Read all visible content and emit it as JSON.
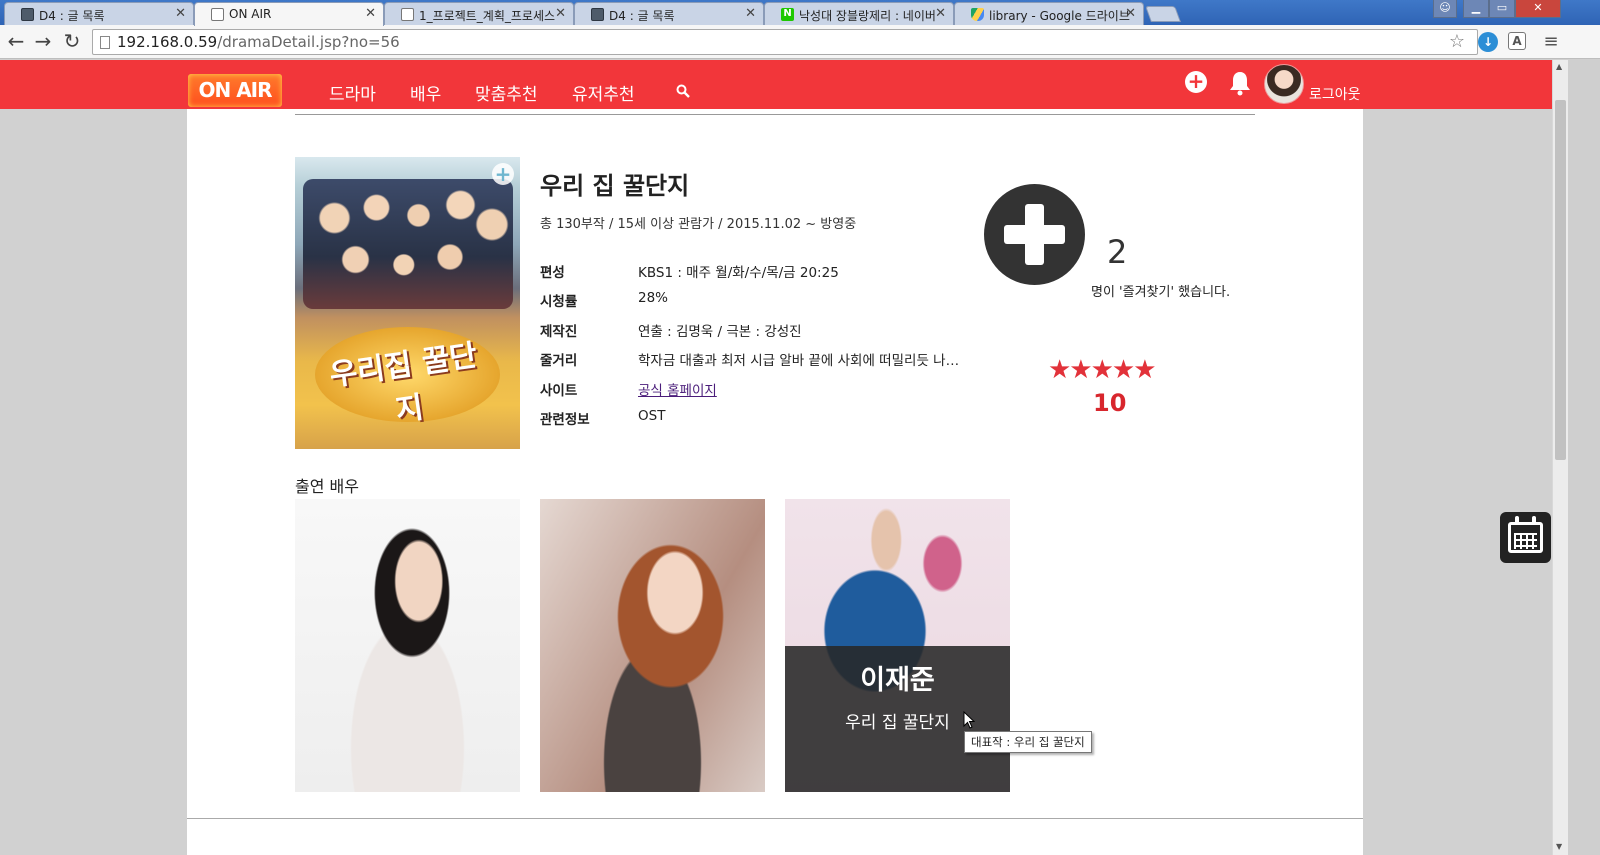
{
  "browser": {
    "tabs": [
      {
        "label": "D4 : 글 목록",
        "favicon": "db-icon"
      },
      {
        "label": "ON AIR",
        "favicon": "page-icon"
      },
      {
        "label": "1_프로젝트_계획_프로세스",
        "favicon": "page-icon"
      },
      {
        "label": "D4 : 글 목록",
        "favicon": "db-icon"
      },
      {
        "label": "낙성대 장블랑제리 : 네이버",
        "favicon": "naver-icon"
      },
      {
        "label": "library - Google 드라이브",
        "favicon": "drive-icon"
      }
    ],
    "url_host": "192.168.0.59",
    "url_path": "/dramaDetail.jsp?no=56"
  },
  "site": {
    "logo": "ON AIR",
    "nav": [
      "드라마",
      "배우",
      "맞춤추천",
      "유저추천"
    ],
    "logout": "로그아웃",
    "brand_color": "#f2363a"
  },
  "drama": {
    "title": "우리 집 꿀단지",
    "poster_title": "우리집 꿀단지",
    "summary": "총 130부작 / 15세 이상 관람가 / 2015.11.02 ~ 방영중",
    "info": [
      {
        "key": "편성",
        "value": "KBS1 : 매주 월/화/수/목/금 20:25"
      },
      {
        "key": "시청률",
        "value": "28%"
      },
      {
        "key": "제작진",
        "value": "연출 : 김명욱 / 극본 : 강성진"
      },
      {
        "key": "줄거리",
        "value": "학자금 대출과 최저 시급 알바 끝에 사회에 떠밀리듯 나온…"
      },
      {
        "key": "사이트",
        "value": "공식 홈페이지"
      },
      {
        "key": "관련정보",
        "value": "OST"
      }
    ]
  },
  "favorites": {
    "count": "2",
    "text": "명이 '즐겨찾기' 했습니다."
  },
  "rating": {
    "stars": "★★★★★",
    "score": "10"
  },
  "cast": {
    "title": "출연 배우",
    "hovered": {
      "name": "이재준",
      "work": "우리 집 꿀단지",
      "tooltip": "대표작 : 우리 집 꿀단지"
    }
  }
}
